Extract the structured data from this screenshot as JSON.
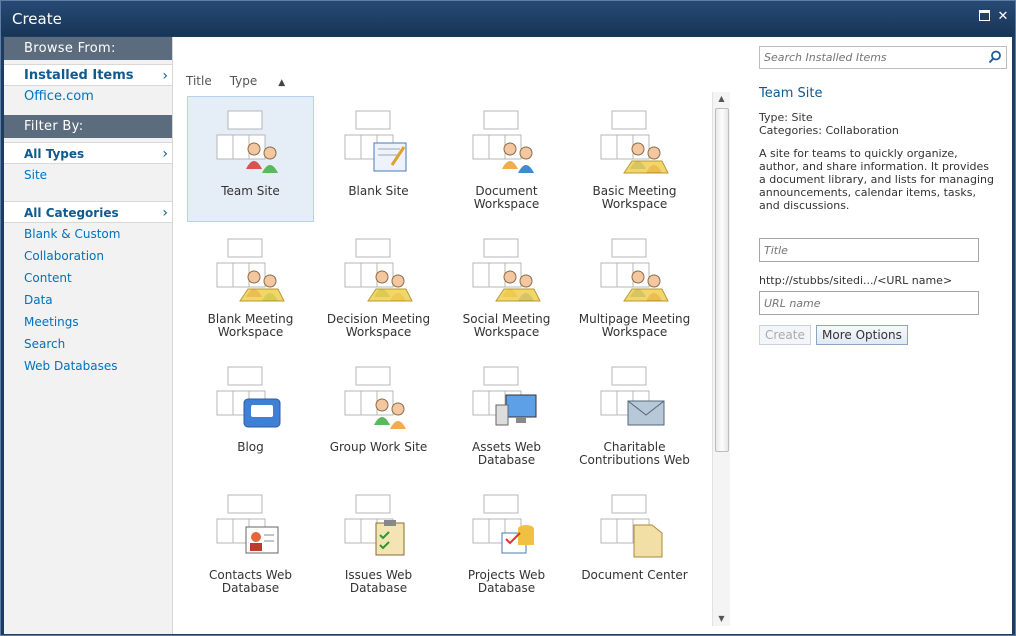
{
  "window": {
    "title": "Create"
  },
  "leftnav": {
    "browse_header": "Browse From:",
    "browse_items": [
      {
        "label": "Installed Items",
        "selected": true
      },
      {
        "label": "Office.com",
        "selected": false
      }
    ],
    "filter_header": "Filter By:",
    "type_items": [
      {
        "label": "All Types",
        "selected": true
      },
      {
        "label": "Site",
        "selected": false
      }
    ],
    "category_items": [
      {
        "label": "All Categories",
        "selected": true
      },
      {
        "label": "Blank & Custom"
      },
      {
        "label": "Collaboration"
      },
      {
        "label": "Content"
      },
      {
        "label": "Data"
      },
      {
        "label": "Meetings"
      },
      {
        "label": "Search"
      },
      {
        "label": "Web Databases"
      }
    ]
  },
  "sort": {
    "title_label": "Title",
    "type_label": "Type"
  },
  "templates": [
    {
      "label": "Team Site",
      "icon": "team-site-icon",
      "selected": true
    },
    {
      "label": "Blank Site",
      "icon": "blank-site-icon"
    },
    {
      "label": "Document Workspace",
      "icon": "document-workspace-icon"
    },
    {
      "label": "Basic Meeting Workspace",
      "icon": "basic-meeting-workspace-icon"
    },
    {
      "label": "Blank Meeting Workspace",
      "icon": "blank-meeting-workspace-icon"
    },
    {
      "label": "Decision Meeting Workspace",
      "icon": "decision-meeting-workspace-icon"
    },
    {
      "label": "Social Meeting Workspace",
      "icon": "social-meeting-workspace-icon"
    },
    {
      "label": "Multipage Meeting Workspace",
      "icon": "multipage-meeting-workspace-icon"
    },
    {
      "label": "Blog",
      "icon": "blog-icon"
    },
    {
      "label": "Group Work Site",
      "icon": "group-work-site-icon"
    },
    {
      "label": "Assets Web Database",
      "icon": "assets-web-database-icon"
    },
    {
      "label": "Charitable Contributions Web",
      "icon": "charitable-contributions-icon"
    },
    {
      "label": "Contacts Web Database",
      "icon": "contacts-web-database-icon"
    },
    {
      "label": "Issues Web Database",
      "icon": "issues-web-database-icon"
    },
    {
      "label": "Projects Web Database",
      "icon": "projects-web-database-icon"
    },
    {
      "label": "Document Center",
      "icon": "document-center-icon"
    }
  ],
  "details": {
    "search_placeholder": "Search Installed Items",
    "title": "Team Site",
    "type_line": "Type: Site",
    "categories_line": "Categories: Collaboration",
    "description": "A site for teams to quickly organize, author, and share information. It provides a document library, and lists for managing announcements, calendar items, tasks, and discussions.",
    "title_placeholder": "Title",
    "url_prefix": "http://stubbs/sitedi.../<URL name>",
    "url_placeholder": "URL name",
    "create_label": "Create",
    "more_options_label": "More Options"
  },
  "colors": {
    "titlebar": "#1d3c62",
    "nav_header": "#5b6c7e",
    "link": "#0072bc",
    "selected_tile": "#e5edf6"
  }
}
